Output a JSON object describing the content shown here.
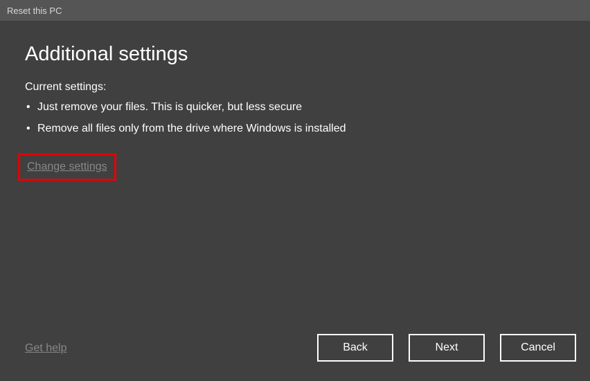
{
  "titlebar": {
    "title": "Reset this PC"
  },
  "page": {
    "heading": "Additional settings",
    "subheading": "Current settings:",
    "bullets": [
      "Just remove your files. This is quicker, but less secure",
      "Remove all files only from the drive where Windows is installed"
    ],
    "change_settings_label": "Change settings",
    "get_help_label": "Get help"
  },
  "buttons": {
    "back": "Back",
    "next": "Next",
    "cancel": "Cancel"
  }
}
